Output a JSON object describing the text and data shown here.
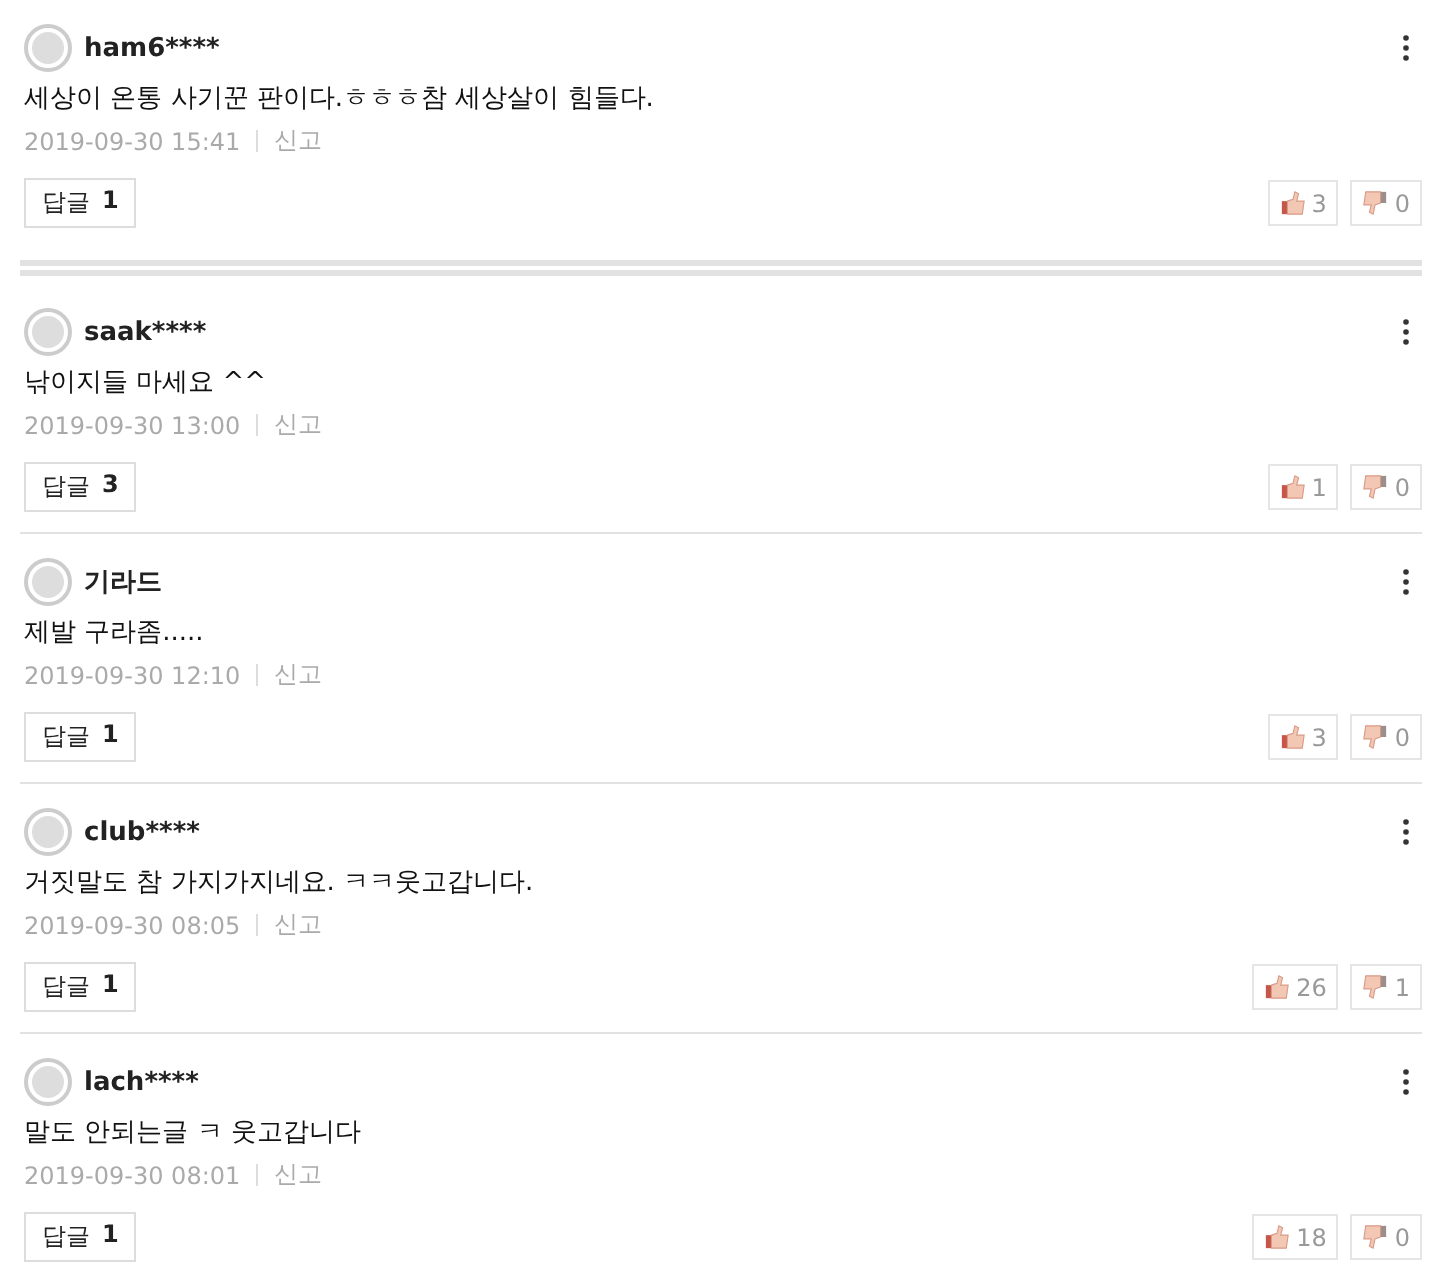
{
  "comments": [
    {
      "user": "ham6****",
      "text": "세상이 온통 사기꾼 판이다.ㅎㅎㅎ참 세상살이 힘들다.",
      "date": "2019-09-30 15:41",
      "report": "신고",
      "reply_label": "답글",
      "reply_count": "1",
      "likes": "3",
      "dislikes": "0"
    },
    {
      "user": "saak****",
      "text": "낚이지들 마세요 ^^",
      "date": "2019-09-30 13:00",
      "report": "신고",
      "reply_label": "답글",
      "reply_count": "3",
      "likes": "1",
      "dislikes": "0"
    },
    {
      "user": "기라드",
      "text": "제발 구라좀.....",
      "date": "2019-09-30 12:10",
      "report": "신고",
      "reply_label": "답글",
      "reply_count": "1",
      "likes": "3",
      "dislikes": "0"
    },
    {
      "user": "club****",
      "text": "거짓말도 참 가지가지네요. ㅋㅋ웃고갑니다.",
      "date": "2019-09-30 08:05",
      "report": "신고",
      "reply_label": "답글",
      "reply_count": "1",
      "likes": "26",
      "dislikes": "1"
    },
    {
      "user": "lach****",
      "text": "말도 안되는글 ㅋ 웃고갑니다",
      "date": "2019-09-30 08:01",
      "report": "신고",
      "reply_label": "답글",
      "reply_count": "1",
      "likes": "18",
      "dislikes": "0"
    }
  ]
}
